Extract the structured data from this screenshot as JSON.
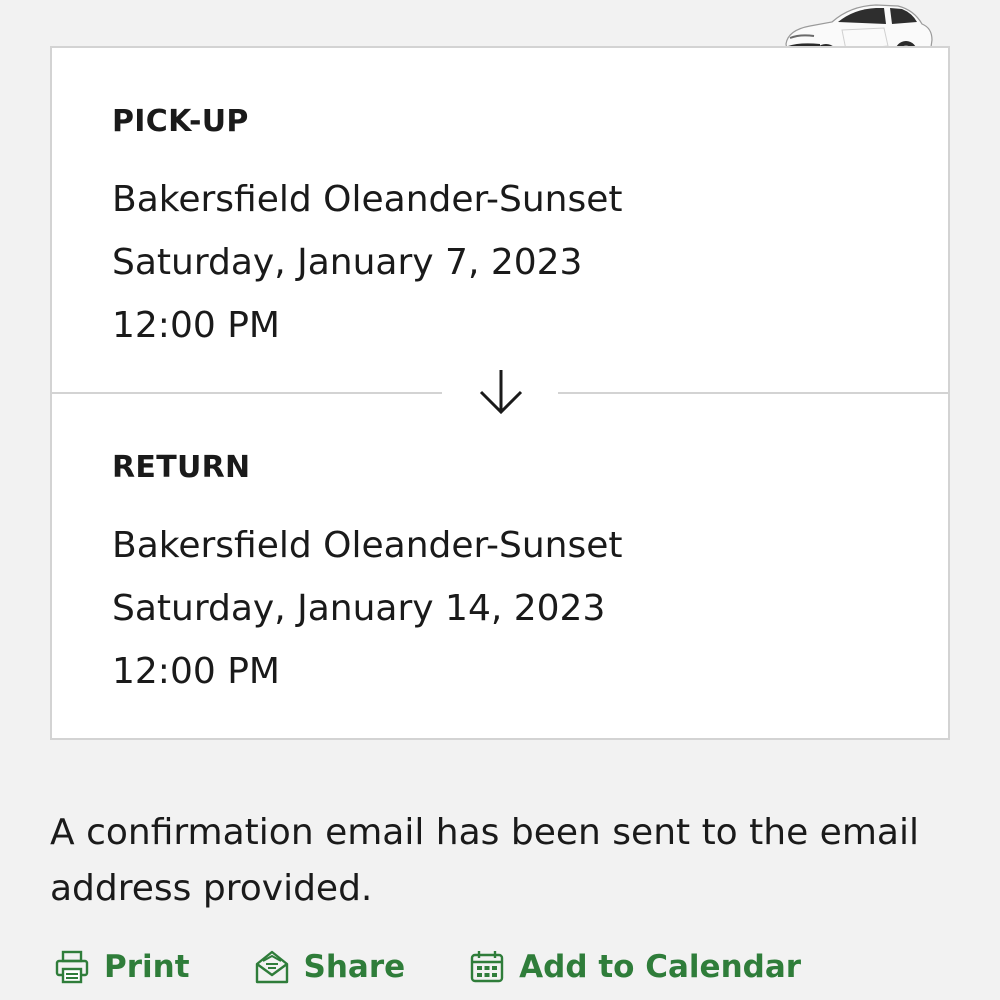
{
  "pickup": {
    "label": "PICK-UP",
    "location": "Bakersfield Oleander-Sunset",
    "date": "Saturday, January 7, 2023",
    "time": "12:00 PM"
  },
  "return": {
    "label": "RETURN",
    "location": "Bakersfield Oleander-Sunset",
    "date": "Saturday, January 14, 2023",
    "time": "12:00 PM"
  },
  "confirmation_text": "A confirmation email has been sent to the email address provided.",
  "actions": {
    "print": {
      "label": "Print",
      "icon": "printer-icon"
    },
    "share": {
      "label": "Share",
      "icon": "share-envelope-icon"
    },
    "calendar": {
      "label": "Add to Calendar",
      "icon": "calendar-icon"
    }
  },
  "colors": {
    "accent": "#2f7d3a",
    "background": "#f2f2f2",
    "card": "#ffffff",
    "border": "#d3d3d3",
    "text": "#1a1a1a"
  }
}
